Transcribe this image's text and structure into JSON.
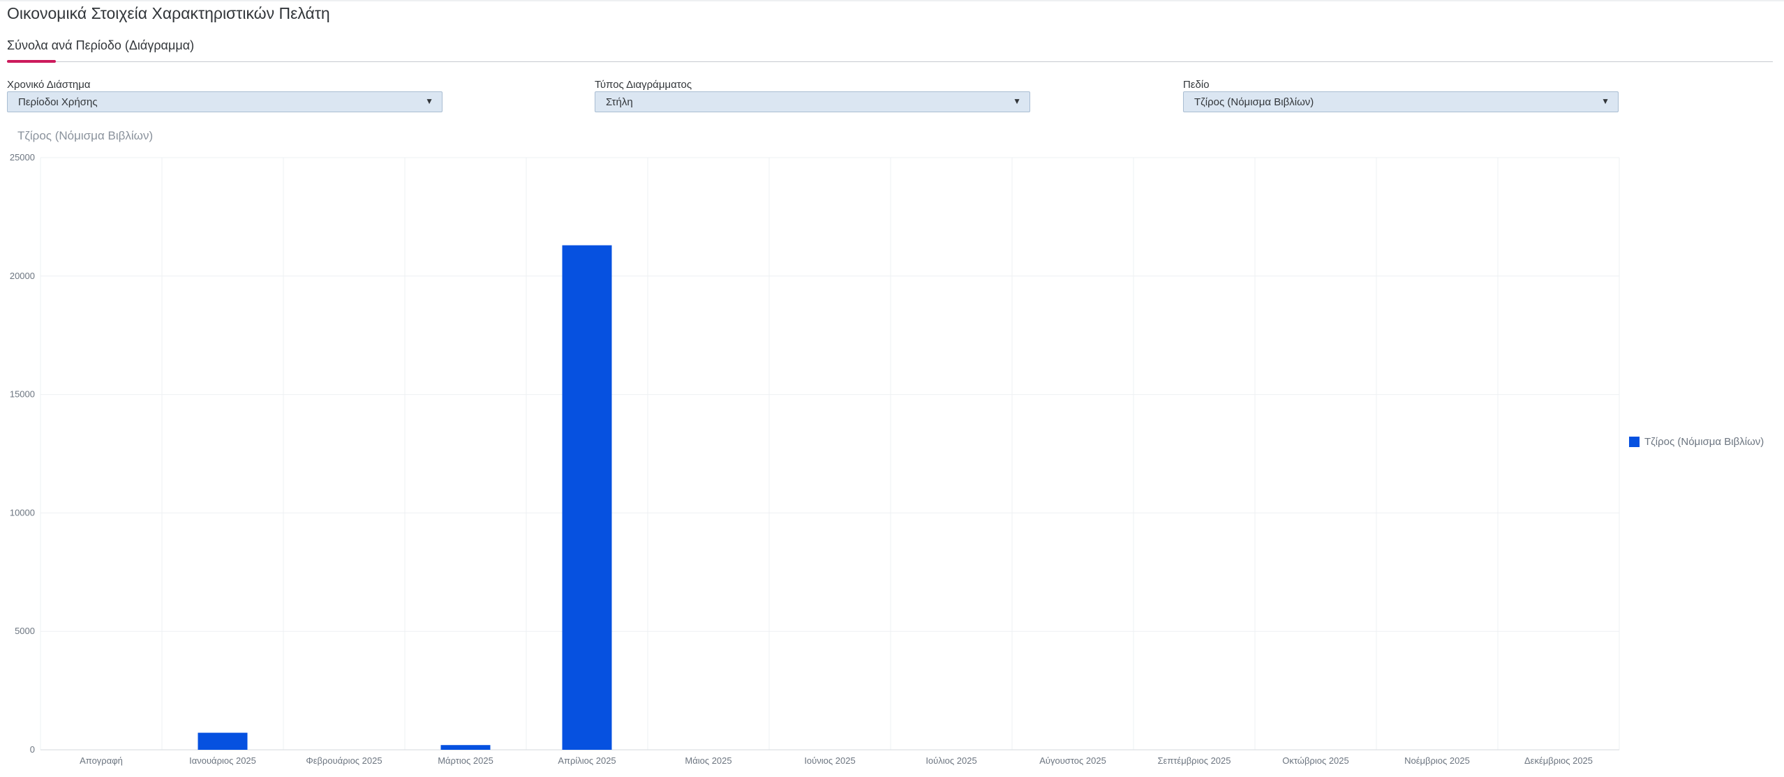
{
  "page": {
    "title": "Οικονομικά Στοιχεία Χαρακτηριστικών Πελάτη",
    "tab_label": "Σύνολα ανά Περίοδο (Διάγραμμα)"
  },
  "filters": {
    "period": {
      "label": "Χρονικό Διάστημα",
      "value": "Περίοδοι Χρήσης"
    },
    "chart_type": {
      "label": "Τύπος Διαγράμματος",
      "value": "Στήλη"
    },
    "field": {
      "label": "Πεδίο",
      "value": "Τζίρος (Νόμισμα Βιβλίων)"
    }
  },
  "icons": {
    "dropdown": "dropdown-caret-icon"
  },
  "colors": {
    "accent": "#cc1a5c",
    "series": "#0651e0",
    "select_bg": "#dbe6f2"
  },
  "chart_data": {
    "type": "bar",
    "ylabel": "Τζίρος (Νόμισμα Βιβλίων)",
    "xlabel": "",
    "categories": [
      "Απογραφή",
      "Ιανουάριος 2025",
      "Φεβρουάριος 2025",
      "Μάρτιος 2025",
      "Απρίλιος 2025",
      "Μάιος 2025",
      "Ιούνιος 2025",
      "Ιούλιος 2025",
      "Αύγουστος 2025",
      "Σεπτέμβριος 2025",
      "Οκτώβριος 2025",
      "Νοέμβριος 2025",
      "Δεκέμβριος 2025"
    ],
    "series": [
      {
        "name": "Τζίρος (Νόμισμα Βιβλίων)",
        "values": [
          0,
          720,
          0,
          200,
          21300,
          0,
          0,
          0,
          0,
          0,
          0,
          0,
          0
        ]
      }
    ],
    "ylim": [
      0,
      25000
    ],
    "yticks": [
      0,
      5000,
      10000,
      15000,
      20000,
      25000
    ],
    "grid": true,
    "legend": "right"
  }
}
